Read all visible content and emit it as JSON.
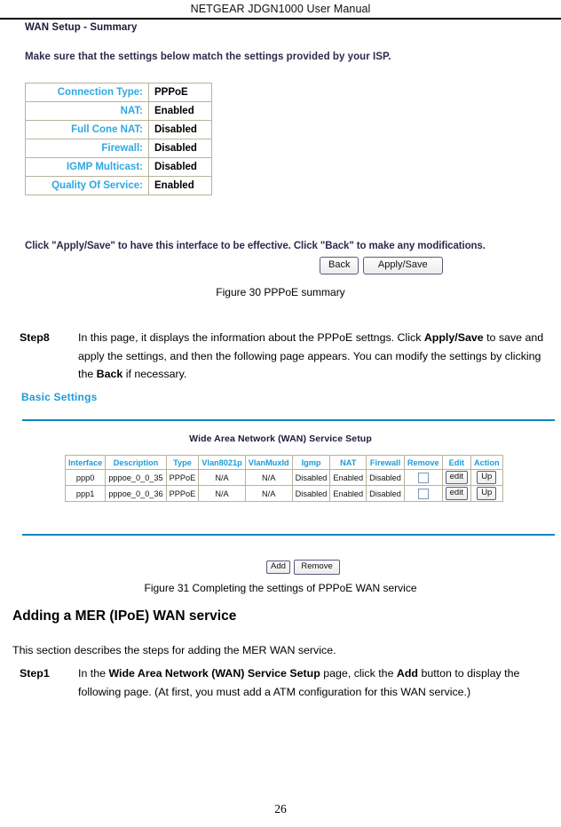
{
  "header": {
    "title": "NETGEAR JDGN1000 User Manual"
  },
  "summary_screenshot": {
    "title": "WAN Setup - Summary",
    "subtitle": "Make sure that the settings below match the settings provided by your ISP.",
    "rows": [
      {
        "key": "Connection Type:",
        "value": "PPPoE"
      },
      {
        "key": "NAT:",
        "value": "Enabled"
      },
      {
        "key": "Full Cone NAT:",
        "value": "Disabled"
      },
      {
        "key": "Firewall:",
        "value": "Disabled"
      },
      {
        "key": "IGMP Multicast:",
        "value": "Disabled"
      },
      {
        "key": "Quality Of Service:",
        "value": "Enabled"
      }
    ],
    "note": "Click \"Apply/Save\" to have this interface to be effective. Click \"Back\" to make any modifications.",
    "back_button": "Back",
    "apply_save_button": "Apply/Save"
  },
  "figure30": {
    "caption": "Figure 30 PPPoE summary"
  },
  "step8": {
    "label": "Step8",
    "line1_a": "In this page, it displays the information about the PPPoE settngs. Click ",
    "line1_b": "Apply/Save",
    "line1_c": " to save and apply the settings, and then the following page appears. You can modify the settings by clicking the ",
    "line1_d": "Back",
    "line1_e": " if necessary."
  },
  "wan_screenshot": {
    "basic_settings_label": "Basic Settings",
    "table_title": "Wide Area Network (WAN) Service Setup",
    "columns": [
      "Interface",
      "Description",
      "Type",
      "Vlan8021p",
      "VlanMuxId",
      "Igmp",
      "NAT",
      "Firewall",
      "Remove",
      "Edit",
      "Action"
    ],
    "rows": [
      {
        "interface": "ppp0",
        "description": "pppoe_0_0_35",
        "type": "PPPoE",
        "vlan8021p": "N/A",
        "vlanmuxid": "N/A",
        "igmp": "Disabled",
        "nat": "Enabled",
        "firewall": "Disabled",
        "remove": "unchecked-checkbox",
        "edit": "edit",
        "action": "Up"
      },
      {
        "interface": "ppp1",
        "description": "pppoe_0_0_36",
        "type": "PPPoE",
        "vlan8021p": "N/A",
        "vlanmuxid": "N/A",
        "igmp": "Disabled",
        "nat": "Enabled",
        "firewall": "Disabled",
        "remove": "unchecked-checkbox",
        "edit": "edit",
        "action": "Up"
      }
    ],
    "add_button": "Add",
    "remove_button": "Remove"
  },
  "figure31": {
    "caption": "Figure 31 Completing the settings of PPPoE WAN service"
  },
  "section": {
    "heading": "Adding a MER (IPoE) WAN service",
    "intro": "This section describes the steps for adding the MER WAN service."
  },
  "step1": {
    "label": "Step1",
    "text_a": "In the ",
    "text_b": "Wide Area Network (WAN) Service Setup",
    "text_c": " page, click the ",
    "text_d": "Add",
    "text_e": " button to display the following page. (At first, you must add a ATM configuration for this WAN service.)"
  },
  "footer": {
    "page_number": "26"
  },
  "colors": {
    "accent_blue": "#1c9cd8",
    "rule_blue": "#0a87c0",
    "table_border": "#b9b39a",
    "key_text": "#2fa8e0"
  }
}
